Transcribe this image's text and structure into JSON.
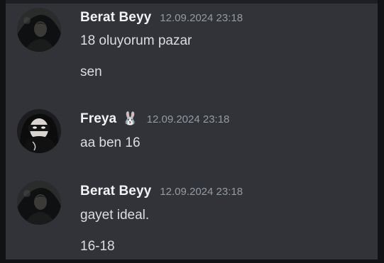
{
  "messages": [
    {
      "author": "Berat Beyy",
      "avatar_icon": "dark-hooded-figure-avatar",
      "timestamp": "12.09.2024 23:18",
      "lines": [
        "18 oluyorum pazar",
        "sen"
      ]
    },
    {
      "author": "Freya",
      "badge": "🐰",
      "avatar_icon": "masked-face-avatar",
      "timestamp": "12.09.2024 23:18",
      "lines": [
        "aa ben 16"
      ]
    },
    {
      "author": "Berat Beyy",
      "avatar_icon": "dark-hooded-figure-avatar",
      "timestamp": "12.09.2024 23:18",
      "lines": [
        "gayet ideal.",
        "16-18"
      ]
    }
  ],
  "colors": {
    "background": "#313338",
    "author": "#f2f3f5",
    "message_text": "#dbdee1",
    "timestamp": "#949ba4"
  }
}
